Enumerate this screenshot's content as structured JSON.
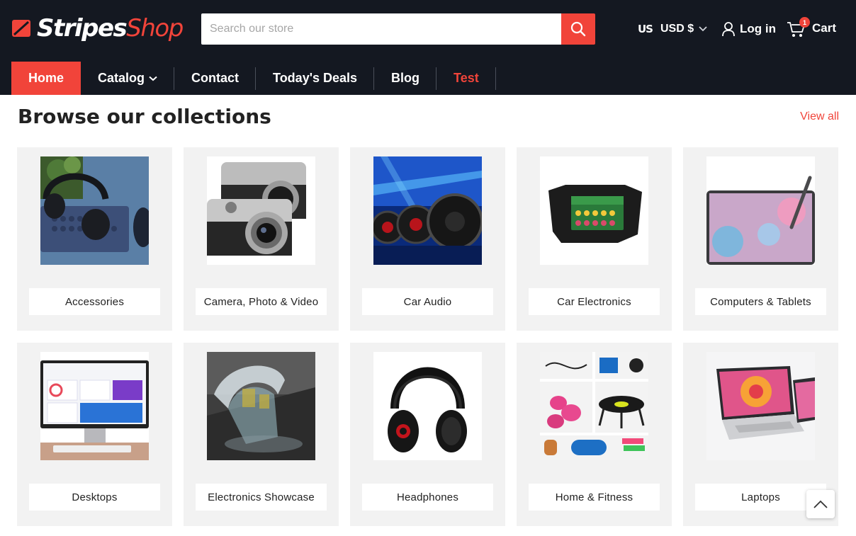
{
  "brand": {
    "part1": "Stripes",
    "part2": "Shop"
  },
  "search": {
    "placeholder": "Search our store"
  },
  "currency": {
    "flag": "US",
    "label": "USD $"
  },
  "account": {
    "login_label": "Log in"
  },
  "cart": {
    "label": "Cart",
    "count": "1"
  },
  "nav": {
    "items": [
      {
        "label": "Home"
      },
      {
        "label": "Catalog"
      },
      {
        "label": "Contact"
      },
      {
        "label": "Today's Deals"
      },
      {
        "label": "Blog"
      },
      {
        "label": "Test"
      }
    ]
  },
  "collections": {
    "title_bold": "Browse our",
    "title_rest": "collections",
    "view_all": "View all",
    "items": [
      {
        "label": "Accessories"
      },
      {
        "label": "Camera, Photo & Video"
      },
      {
        "label": "Car Audio"
      },
      {
        "label": "Car Electronics"
      },
      {
        "label": "Computers & Tablets"
      },
      {
        "label": "Desktops"
      },
      {
        "label": "Electronics Showcase"
      },
      {
        "label": "Headphones"
      },
      {
        "label": "Home & Fitness"
      },
      {
        "label": "Laptops"
      }
    ]
  },
  "colors": {
    "header_bg": "#141821",
    "accent": "#f1443a",
    "card_bg": "#f2f2f2"
  }
}
